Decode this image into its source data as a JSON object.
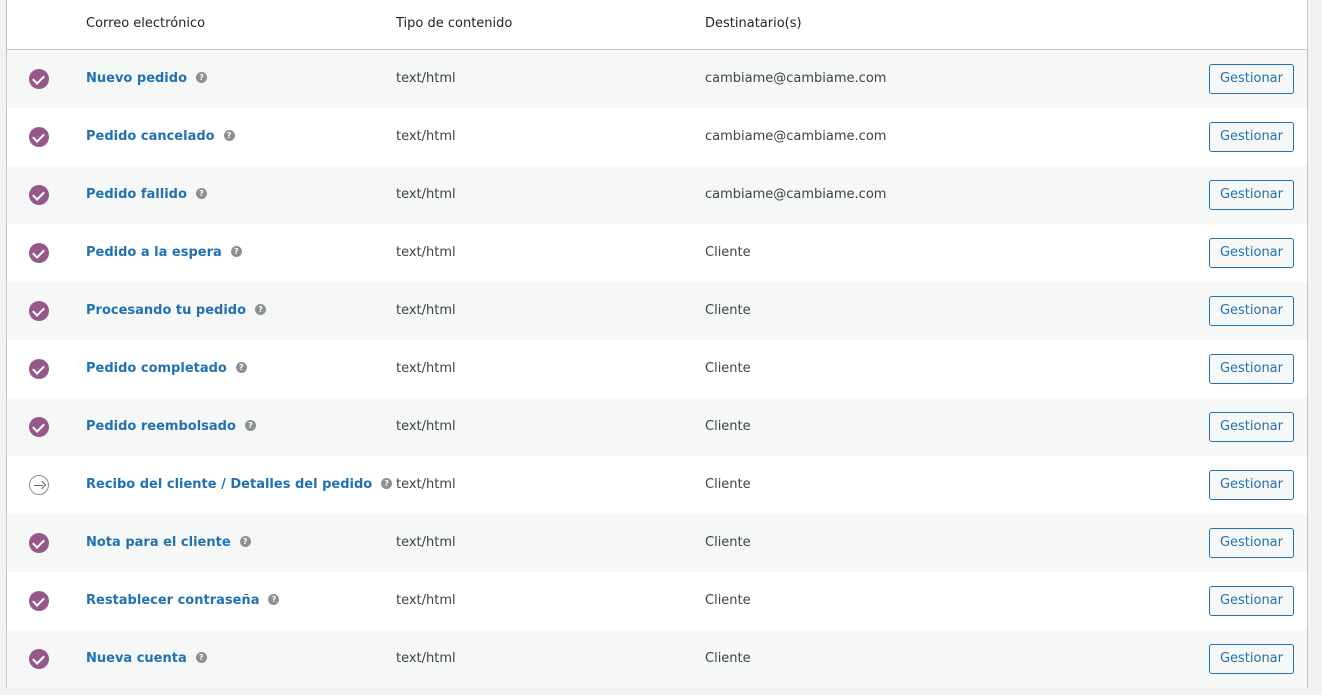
{
  "table": {
    "headers": {
      "email": "Correo electrónico",
      "content_type": "Tipo de contenido",
      "recipients": "Destinatario(s)"
    },
    "manage_label": "Gestionar",
    "help_glyph": "?",
    "rows": [
      {
        "name": "Nuevo pedido",
        "type": "text/html",
        "recipient": "cambiame@cambiame.com",
        "status": "enabled"
      },
      {
        "name": "Pedido cancelado",
        "type": "text/html",
        "recipient": "cambiame@cambiame.com",
        "status": "enabled"
      },
      {
        "name": "Pedido fallido",
        "type": "text/html",
        "recipient": "cambiame@cambiame.com",
        "status": "enabled"
      },
      {
        "name": "Pedido a la espera",
        "type": "text/html",
        "recipient": "Cliente",
        "status": "enabled"
      },
      {
        "name": "Procesando tu pedido",
        "type": "text/html",
        "recipient": "Cliente",
        "status": "enabled"
      },
      {
        "name": "Pedido completado",
        "type": "text/html",
        "recipient": "Cliente",
        "status": "enabled"
      },
      {
        "name": "Pedido reembolsado",
        "type": "text/html",
        "recipient": "Cliente",
        "status": "enabled"
      },
      {
        "name": "Recibo del cliente / Detalles del pedido",
        "type": "text/html",
        "recipient": "Cliente",
        "status": "manual"
      },
      {
        "name": "Nota para el cliente",
        "type": "text/html",
        "recipient": "Cliente",
        "status": "enabled"
      },
      {
        "name": "Restablecer contraseña",
        "type": "text/html",
        "recipient": "Cliente",
        "status": "enabled"
      },
      {
        "name": "Nueva cuenta",
        "type": "text/html",
        "recipient": "Cliente",
        "status": "enabled"
      }
    ]
  },
  "colors": {
    "enabled_icon": "#96588a",
    "link": "#2271b1",
    "row_alt": "#f6f7f7"
  }
}
